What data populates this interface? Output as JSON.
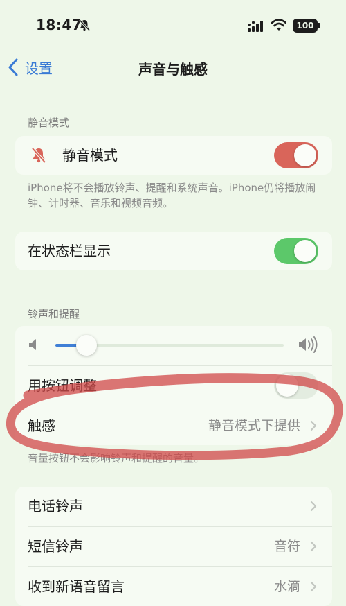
{
  "status": {
    "time": "18:47",
    "battery": "100",
    "icons": [
      "bell-off-icon",
      "cellular-signal-icon",
      "wifi-icon",
      "battery-icon"
    ]
  },
  "nav": {
    "back_label": "设置",
    "title": "声音与触感"
  },
  "silent": {
    "header": "静音模式",
    "label": "静音模式",
    "on": true,
    "toggle_color": "#d9655a",
    "note": "iPhone将不会播放铃声、提醒和系统声音。iPhone仍将播放闹钟、计时器、音乐和视频音频。"
  },
  "statusbar_show": {
    "label": "在状态栏显示",
    "on": true,
    "toggle_color": "#5cc86a"
  },
  "ringer": {
    "header": "铃声和提醒",
    "volume_level": 0.1,
    "adjust_label": "用按钮调整",
    "adjust_on": false,
    "haptics_label": "触感",
    "haptics_value": "静音模式下提供",
    "note": "音量按钮不会影响铃声和提醒的音量。"
  },
  "sounds": {
    "items": [
      {
        "label": "电话铃声",
        "value": ""
      },
      {
        "label": "短信铃声",
        "value": "音符"
      },
      {
        "label": "收到新语音留言",
        "value": "水滴"
      }
    ]
  },
  "annotation_color": "#d04848"
}
